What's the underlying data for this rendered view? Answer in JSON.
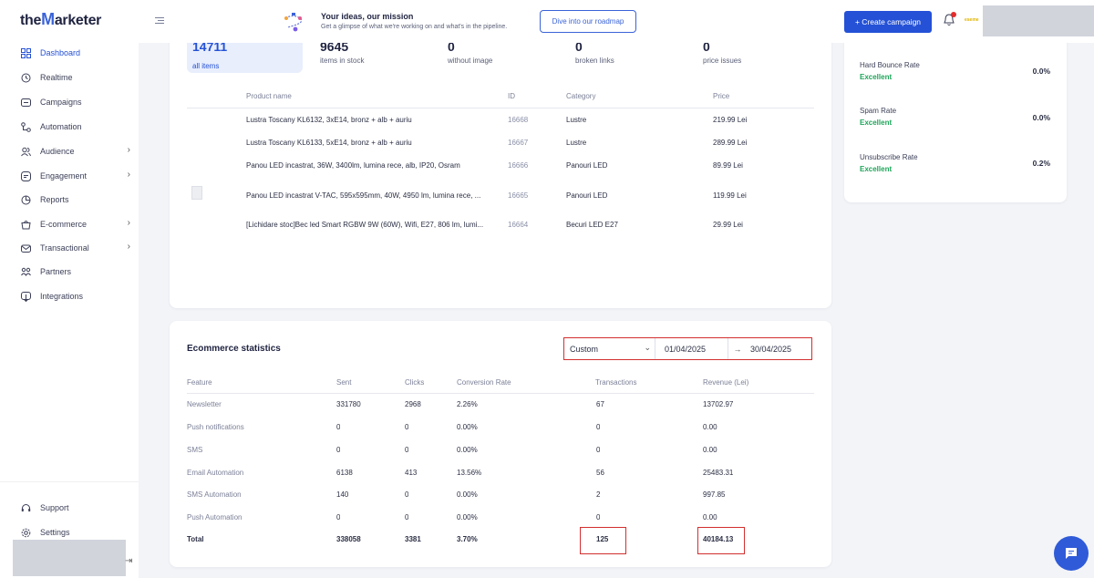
{
  "topbar": {
    "logo_prefix": "the",
    "logo_m": "M",
    "logo_suffix": "arketer",
    "announce_title": "Your ideas, our mission",
    "announce_sub": "Get a glimpse of what we're working on and what's in the pipeline.",
    "roadmap_btn": "Dive into our roadmap",
    "create_btn": "+ Create campaign",
    "brand_logo": "eseme"
  },
  "sidebar": {
    "items": [
      {
        "label": "Dashboard",
        "icon": "dashboard-icon"
      },
      {
        "label": "Realtime",
        "icon": "realtime-icon"
      },
      {
        "label": "Campaigns",
        "icon": "campaigns-icon"
      },
      {
        "label": "Automation",
        "icon": "automation-icon"
      },
      {
        "label": "Audience",
        "icon": "audience-icon"
      },
      {
        "label": "Engagement",
        "icon": "engagement-icon"
      },
      {
        "label": "Reports",
        "icon": "reports-icon"
      },
      {
        "label": "E-commerce",
        "icon": "ecommerce-icon"
      },
      {
        "label": "Transactional",
        "icon": "transactional-icon"
      },
      {
        "label": "Partners",
        "icon": "partners-icon"
      },
      {
        "label": "Integrations",
        "icon": "integrations-icon"
      }
    ],
    "support": "Support",
    "settings": "Settings"
  },
  "products": {
    "stats": [
      {
        "num": "14711",
        "label": "all items"
      },
      {
        "num": "9645",
        "label": "items in stock"
      },
      {
        "num": "0",
        "label": "without image"
      },
      {
        "num": "0",
        "label": "broken links"
      },
      {
        "num": "0",
        "label": "price issues"
      }
    ],
    "headers": {
      "name": "Product name",
      "id": "ID",
      "category": "Category",
      "price": "Price"
    },
    "rows": [
      {
        "name": "Lustra Toscany KL6132, 3xE14, bronz + alb + auriu",
        "id": "16668",
        "category": "Lustre",
        "price": "219.99 Lei"
      },
      {
        "name": "Lustra Toscany KL6133, 5xE14, bronz + alb + auriu",
        "id": "16667",
        "category": "Lustre",
        "price": "289.99 Lei"
      },
      {
        "name": "Panou LED incastrat, 36W, 3400lm, lumina rece, alb, IP20, Osram",
        "id": "16666",
        "category": "Panouri LED",
        "price": "89.99 Lei"
      },
      {
        "name": "Panou LED incastrat V-TAC, 595x595mm, 40W, 4950 lm, lumina rece, ...",
        "id": "16665",
        "category": "Panouri LED",
        "price": "119.99 Lei"
      },
      {
        "name": "[Lichidare stoc]Bec led Smart RGBW 9W (60W), Wifi, E27, 806 lm, lumi...",
        "id": "16664",
        "category": "Becuri LED E27",
        "price": "29.99 Lei"
      }
    ]
  },
  "ecommerce": {
    "title": "Ecommerce statistics",
    "range_select": "Custom",
    "date_from": "01/04/2025",
    "date_arrow": "→",
    "date_to": "30/04/2025",
    "headers": {
      "feature": "Feature",
      "sent": "Sent",
      "clicks": "Clicks",
      "conversion": "Conversion Rate",
      "transactions": "Transactions",
      "revenue": "Revenue (Lei)"
    },
    "rows": [
      {
        "feature": "Newsletter",
        "sent": "331780",
        "clicks": "2968",
        "conversion": "2.26%",
        "transactions": "67",
        "revenue": "13702.97"
      },
      {
        "feature": "Push notifications",
        "sent": "0",
        "clicks": "0",
        "conversion": "0.00%",
        "transactions": "0",
        "revenue": "0.00"
      },
      {
        "feature": "SMS",
        "sent": "0",
        "clicks": "0",
        "conversion": "0.00%",
        "transactions": "0",
        "revenue": "0.00"
      },
      {
        "feature": "Email Automation",
        "sent": "6138",
        "clicks": "413",
        "conversion": "13.56%",
        "transactions": "56",
        "revenue": "25483.31"
      },
      {
        "feature": "SMS Automation",
        "sent": "140",
        "clicks": "0",
        "conversion": "0.00%",
        "transactions": "2",
        "revenue": "997.85"
      },
      {
        "feature": "Push Automation",
        "sent": "0",
        "clicks": "0",
        "conversion": "0.00%",
        "transactions": "0",
        "revenue": "0.00"
      }
    ],
    "total": {
      "feature": "Total",
      "sent": "338058",
      "clicks": "3381",
      "conversion": "3.70%",
      "transactions": "125",
      "revenue": "40184.13"
    }
  },
  "rates": [
    {
      "name": "Hard Bounce Rate",
      "status": "Excellent",
      "value": "0.0%"
    },
    {
      "name": "Spam Rate",
      "status": "Excellent",
      "value": "0.0%"
    },
    {
      "name": "Unsubscribe Rate",
      "status": "Excellent",
      "value": "0.2%"
    }
  ],
  "colors": {
    "accent": "#2451d6",
    "excellent": "#1fa55a",
    "highlight": "#d32f2f"
  }
}
